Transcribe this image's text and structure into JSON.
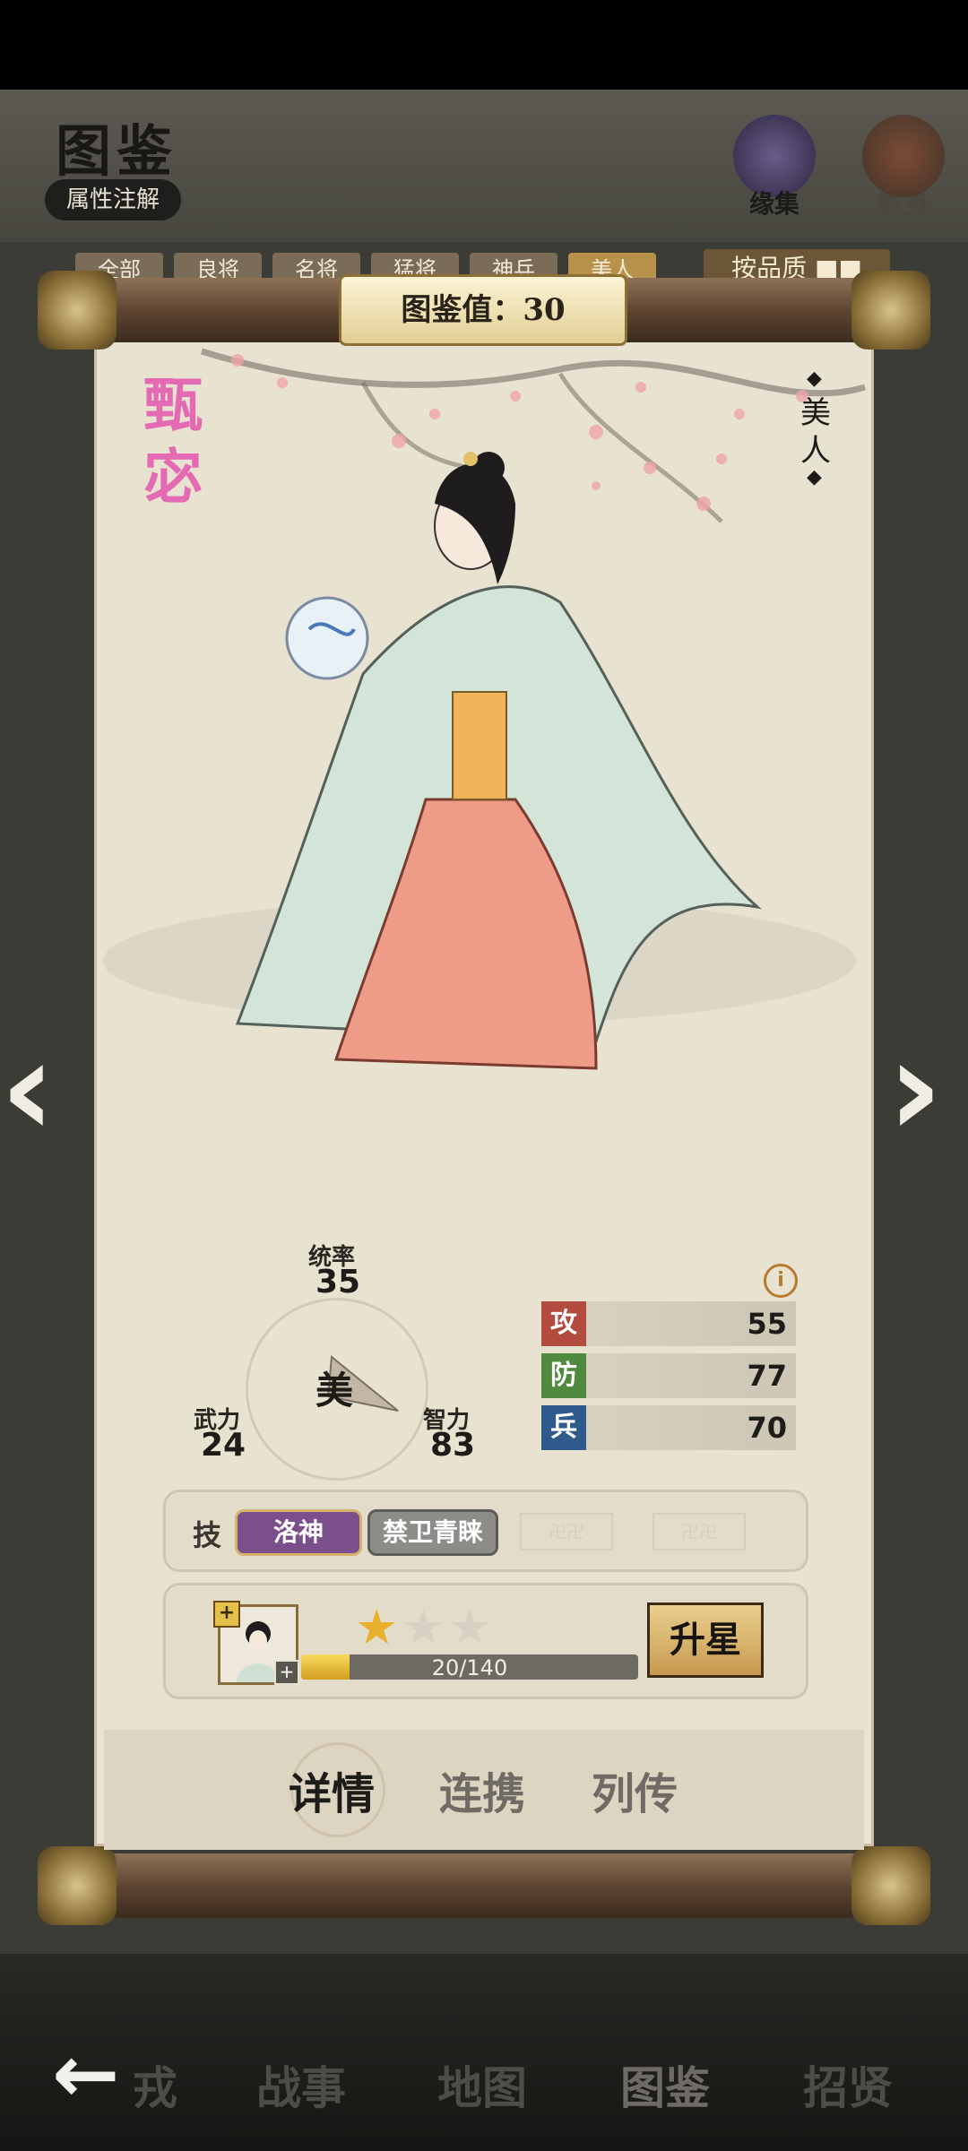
{
  "header": {
    "title": "图鉴",
    "attr_button": "属性注解",
    "icons": [
      {
        "label": "缘集",
        "icon": "bond-collection-icon"
      },
      {
        "label": "群英",
        "icon": "heroes-icon"
      }
    ],
    "filter_tabs": [
      "全部",
      "良将",
      "名将",
      "猛将",
      "神兵",
      "美人"
    ],
    "sort_button": "按品质 ■■"
  },
  "scroll": {
    "value_label": "图鉴值：30",
    "hero_name": "甄宓",
    "hero_type": "美人"
  },
  "stats": {
    "tongshuai": {
      "label": "统率",
      "value": "35"
    },
    "wuli": {
      "label": "武力",
      "value": "24"
    },
    "zhili": {
      "label": "智力",
      "value": "83"
    },
    "center": "美",
    "bars": [
      {
        "icon": "攻",
        "value": "55",
        "color": "#b34b3f"
      },
      {
        "icon": "防",
        "value": "77",
        "color": "#4f8a3e"
      },
      {
        "icon": "兵",
        "value": "70",
        "color": "#2f5b8c"
      }
    ],
    "info_icon": "i"
  },
  "skills": {
    "label": "技",
    "items": [
      {
        "name": "洛神",
        "color": "#7b4e8c"
      },
      {
        "name": "禁卫青睐",
        "color": "#8e8c88"
      }
    ]
  },
  "upgrade": {
    "stars_filled": 1,
    "stars_total": 3,
    "xp_text": "20/140",
    "xp_fraction": 0.143,
    "button": "升星"
  },
  "tabs": [
    {
      "label": "详情",
      "active": true
    },
    {
      "label": "连携",
      "active": false
    },
    {
      "label": "列传",
      "active": false
    }
  ],
  "bottom_nav": [
    "戎",
    "战事",
    "地图",
    "图鉴",
    "招贤"
  ],
  "colors": {
    "name_pink": "#e46ab4",
    "rod_brown": "#5b4330",
    "gold": "#d4a93a"
  }
}
